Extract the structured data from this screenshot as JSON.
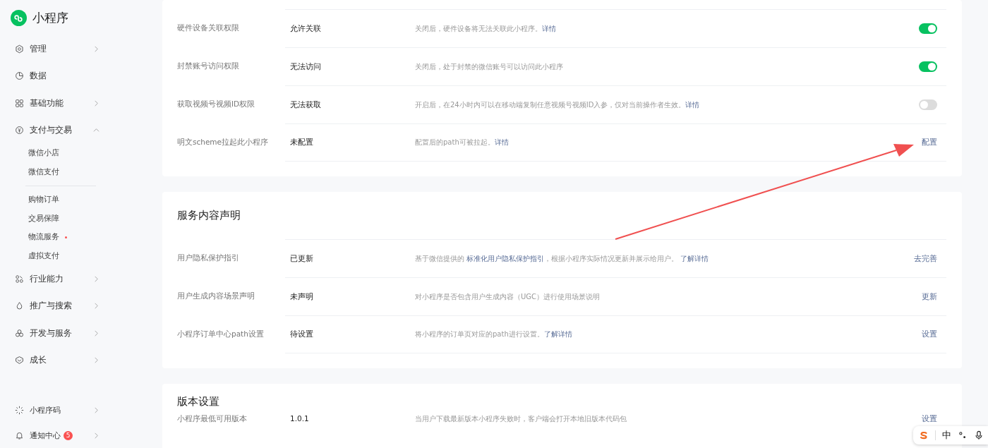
{
  "brand": {
    "title": "小程序"
  },
  "nav": [
    {
      "label": "管理",
      "chevron": true,
      "expanded": false
    },
    {
      "label": "数据",
      "chevron": false
    },
    {
      "label": "基础功能",
      "chevron": true,
      "expanded": false
    },
    {
      "label": "支付与交易",
      "chevron": true,
      "expanded": true,
      "groups": [
        [
          {
            "label": "微信小店",
            "dot": false
          },
          {
            "label": "微信支付",
            "dot": false
          }
        ],
        [
          {
            "label": "购物订单",
            "dot": false
          },
          {
            "label": "交易保障",
            "dot": false
          },
          {
            "label": "物流服务",
            "dot": true
          },
          {
            "label": "虚拟支付",
            "dot": false
          }
        ]
      ]
    },
    {
      "label": "行业能力",
      "chevron": true,
      "expanded": false
    },
    {
      "label": "推广与搜索",
      "chevron": true,
      "expanded": false
    },
    {
      "label": "开发与服务",
      "chevron": true,
      "expanded": false
    },
    {
      "label": "成长",
      "chevron": true,
      "expanded": false
    }
  ],
  "bottom_nav": [
    {
      "label": "小程序码"
    },
    {
      "label": "通知中心",
      "badge": "5"
    }
  ],
  "sections": [
    {
      "rows": [
        {
          "kind": "toggle",
          "label": "硬件设备关联权限",
          "value": "允许关联",
          "description": [
            {
              "text": "关闭后，硬件设备将无法关联此小程序。",
              "link": false
            },
            {
              "text": "详情",
              "link": true
            }
          ],
          "on": true
        },
        {
          "kind": "toggle",
          "label": "封禁账号访问权限",
          "value": "无法访问",
          "description": [
            {
              "text": "关闭后，处于封禁的微信账号可以访问此小程序",
              "link": false
            }
          ],
          "on": true
        },
        {
          "kind": "toggle",
          "label": "获取视频号视频ID权限",
          "value": "无法获取",
          "description": [
            {
              "text": "开启后，在24小时内可以在移动端复制任意视频号视频ID入参，仅对当前操作者生效。",
              "link": false
            },
            {
              "text": "详情",
              "link": true
            }
          ],
          "on": false
        },
        {
          "kind": "action",
          "label": "明文scheme拉起此小程序",
          "value": "未配置",
          "description": [
            {
              "text": "配置后的path可被拉起。",
              "link": false
            },
            {
              "text": "详情",
              "link": true
            }
          ],
          "action": "配置"
        }
      ]
    },
    {
      "title": "服务内容声明",
      "rows": [
        {
          "kind": "action",
          "label": "用户隐私保护指引",
          "value": "已更新",
          "description": [
            {
              "text": "基于微信提供的 ",
              "link": false
            },
            {
              "text": "标准化用户隐私保护指引",
              "link": true
            },
            {
              "text": "，根据小程序实际情况更新并展示给用户。 ",
              "link": false
            },
            {
              "text": "了解详情",
              "link": true
            }
          ],
          "action": "去完善"
        },
        {
          "kind": "action",
          "label": "用户生成内容场景声明",
          "value": "未声明",
          "description": [
            {
              "text": "对小程序是否包含用户生成内容（UGC）进行使用场景说明",
              "link": false
            }
          ],
          "action": "更新"
        },
        {
          "kind": "action",
          "label": "小程序订单中心path设置",
          "value": "待设置",
          "description": [
            {
              "text": "将小程序的订单页对应的path进行设置。",
              "link": false
            },
            {
              "text": "了解详情",
              "link": true
            }
          ],
          "action": "设置"
        }
      ]
    },
    {
      "title": "版本设置",
      "rows": [
        {
          "kind": "action",
          "label": "小程序最低可用版本",
          "value": "1.0.1",
          "description": [
            {
              "text": "当用户下载最新版本小程序失败时，客户端会打开本地旧版本代码包",
              "link": false
            }
          ],
          "action": "设置"
        }
      ]
    }
  ],
  "ime_bar": {
    "mode": "中"
  }
}
